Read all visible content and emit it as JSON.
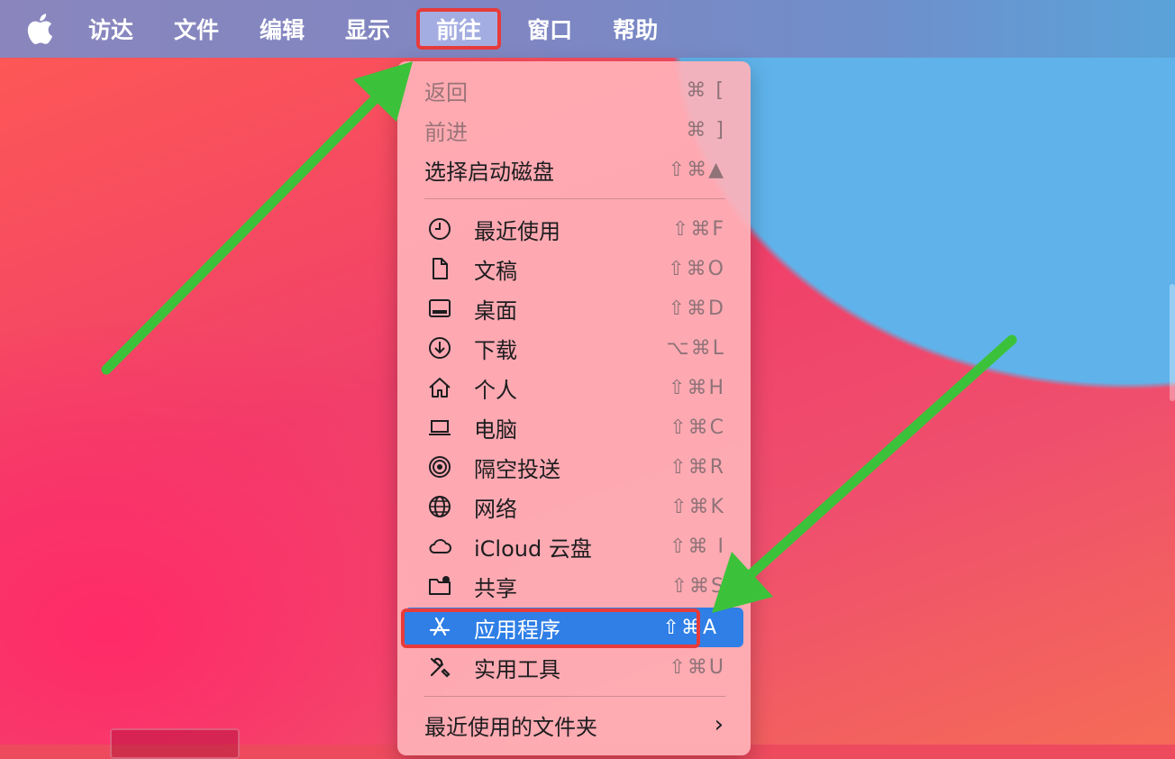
{
  "menubar": {
    "items": [
      "访达",
      "文件",
      "编辑",
      "显示",
      "前往",
      "窗口",
      "帮助"
    ]
  },
  "dropdown": {
    "top_items": [
      {
        "label": "返回",
        "shortcut": "⌘ [",
        "enabled": false
      },
      {
        "label": "前进",
        "shortcut": "⌘ ]",
        "enabled": false
      },
      {
        "label": "选择启动磁盘",
        "shortcut": "⇧⌘▲",
        "enabled": true
      }
    ],
    "places": [
      {
        "label": "最近使用",
        "shortcut": "⇧⌘F",
        "icon": "clock-icon"
      },
      {
        "label": "文稿",
        "shortcut": "⇧⌘O",
        "icon": "document-icon"
      },
      {
        "label": "桌面",
        "shortcut": "⇧⌘D",
        "icon": "desktop-icon"
      },
      {
        "label": "下载",
        "shortcut": "⌥⌘L",
        "icon": "download-icon"
      },
      {
        "label": "个人",
        "shortcut": "⇧⌘H",
        "icon": "home-icon"
      },
      {
        "label": "电脑",
        "shortcut": "⇧⌘C",
        "icon": "laptop-icon"
      },
      {
        "label": "隔空投送",
        "shortcut": "⇧⌘R",
        "icon": "airdrop-icon"
      },
      {
        "label": "网络",
        "shortcut": "⇧⌘K",
        "icon": "globe-icon"
      },
      {
        "label": "iCloud 云盘",
        "shortcut": "⇧⌘ I",
        "icon": "cloud-icon"
      },
      {
        "label": "共享",
        "shortcut": "⇧⌘S",
        "icon": "shared-folder-icon"
      },
      {
        "label": "应用程序",
        "shortcut": "⇧⌘A",
        "icon": "appstore-icon"
      },
      {
        "label": "实用工具",
        "shortcut": "⇧⌘U",
        "icon": "tools-icon"
      }
    ],
    "recent_folders": {
      "label": "最近使用的文件夹",
      "chevron": "›"
    }
  },
  "colors": {
    "highlight_box": "#e73b3b",
    "selected_row": "#2f7fe6",
    "arrow": "#3cc23a"
  }
}
